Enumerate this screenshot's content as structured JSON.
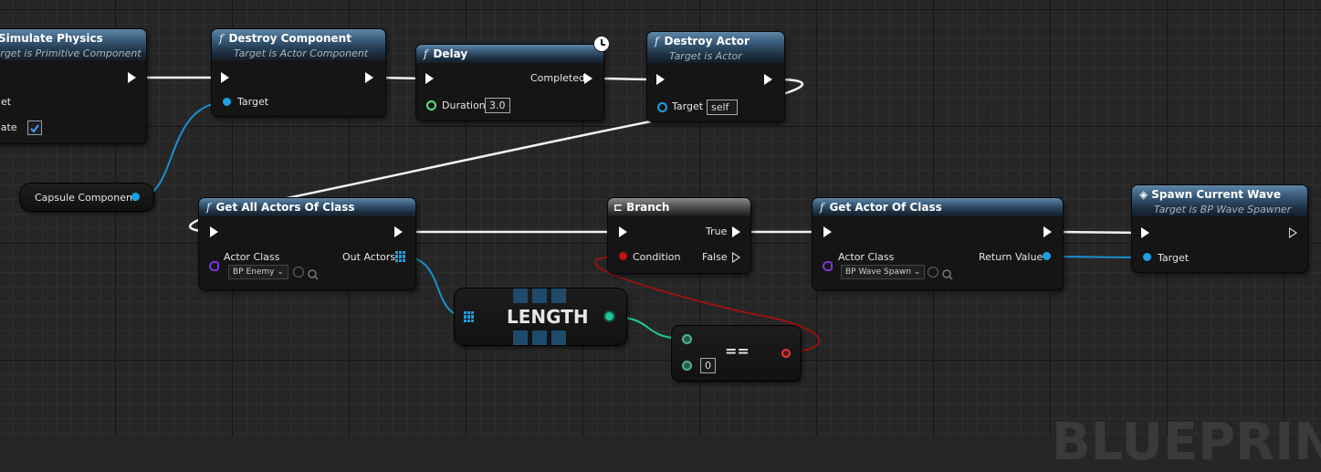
{
  "watermark": "BLUEPRINT",
  "nodes": {
    "simulate_physics": {
      "title": "Simulate Physics",
      "subtitle": "Target is Primitive Component",
      "pin_target": "Target",
      "pin_simulate": "Simulate",
      "simulate_checked": true
    },
    "destroy_component": {
      "title": "Destroy Component",
      "subtitle": "Target is Actor Component",
      "pin_target": "Target"
    },
    "delay": {
      "title": "Delay",
      "pin_completed": "Completed",
      "pin_duration": "Duration",
      "duration_value": "3.0"
    },
    "destroy_actor": {
      "title": "Destroy Actor",
      "subtitle": "Target is Actor",
      "pin_target": "Target",
      "target_value": "self"
    },
    "capsule": {
      "label": "Capsule Component"
    },
    "get_all_actors": {
      "title": "Get All Actors Of Class",
      "pin_actor_class": "Actor Class",
      "pin_out_actors": "Out Actors",
      "class_value": "BP Enemy"
    },
    "branch": {
      "title": "Branch",
      "pin_true": "True",
      "pin_false": "False",
      "pin_condition": "Condition"
    },
    "get_actor": {
      "title": "Get Actor Of Class",
      "pin_actor_class": "Actor Class",
      "pin_return": "Return Value",
      "class_value": "BP Wave Spawn"
    },
    "spawn_wave": {
      "title": "Spawn Current Wave",
      "subtitle": "Target is BP Wave Spawner",
      "pin_target": "Target"
    },
    "length": {
      "label": "LENGTH"
    },
    "equals": {
      "label": "==",
      "b_value": "0"
    }
  },
  "colors": {
    "exec": "#ffffff",
    "object": "#1aa0e4",
    "bool": "#c0120f",
    "int": "#1fc79a",
    "class": "#7f34d8",
    "float": "#5de27a"
  }
}
